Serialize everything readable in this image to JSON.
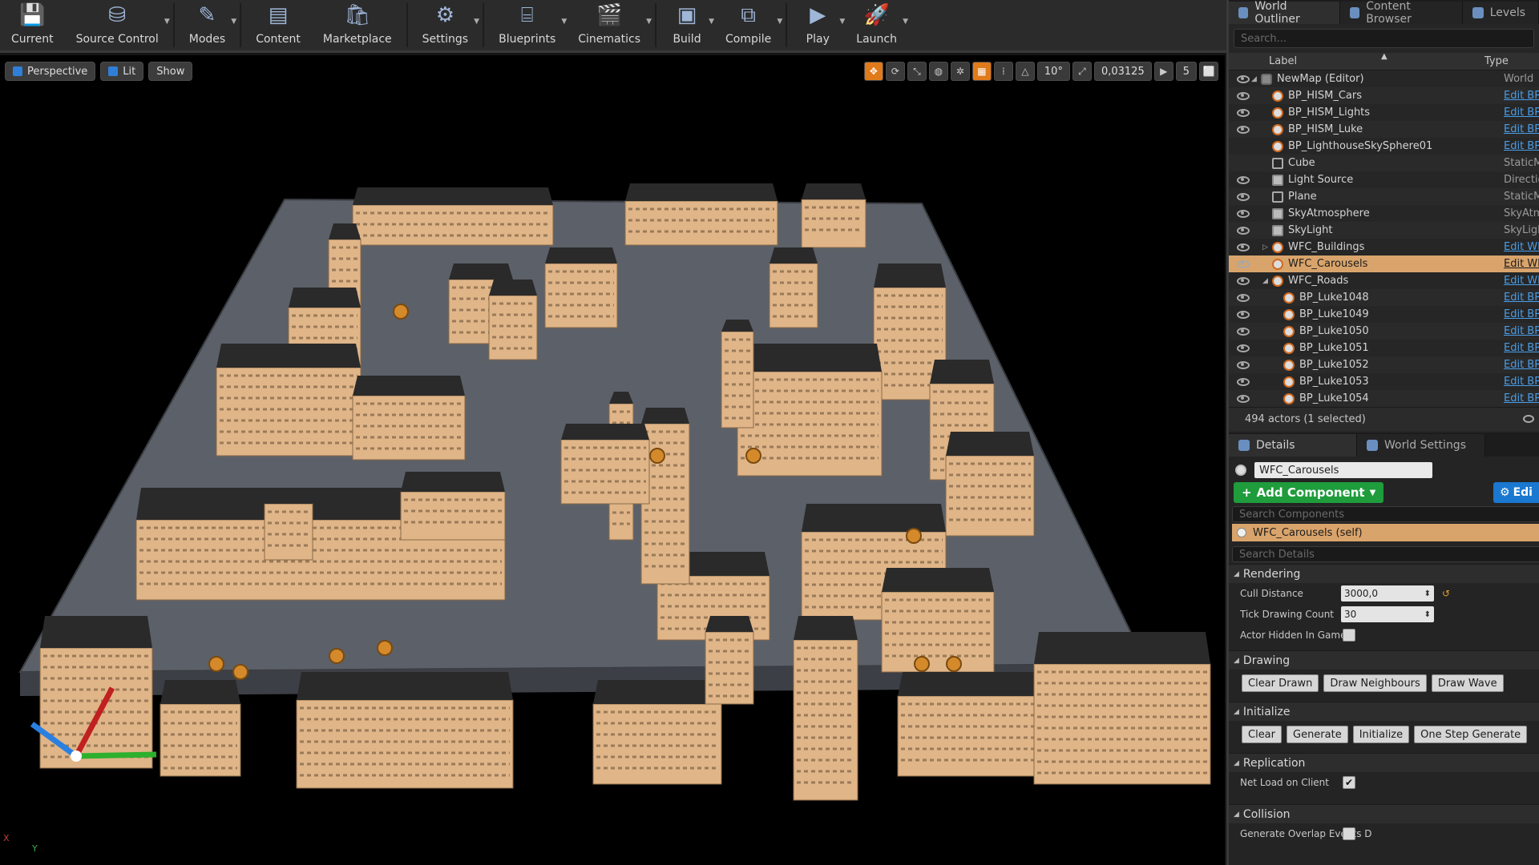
{
  "toolbar": {
    "buttons": [
      {
        "label": "Current",
        "icon": "save-icon",
        "caret": false
      },
      {
        "label": "Source Control",
        "icon": "source-control-icon",
        "caret": true
      },
      {
        "label": "Modes",
        "icon": "modes-icon",
        "caret": true
      },
      {
        "label": "Content",
        "icon": "content-icon",
        "caret": false
      },
      {
        "label": "Marketplace",
        "icon": "marketplace-icon",
        "caret": false
      },
      {
        "label": "Settings",
        "icon": "settings-icon",
        "caret": true
      },
      {
        "label": "Blueprints",
        "icon": "blueprints-icon",
        "caret": true
      },
      {
        "label": "Cinematics",
        "icon": "cinematics-icon",
        "caret": true
      },
      {
        "label": "Build",
        "icon": "build-icon",
        "caret": true
      },
      {
        "label": "Compile",
        "icon": "compile-icon",
        "caret": true
      },
      {
        "label": "Play",
        "icon": "play-icon",
        "caret": true
      },
      {
        "label": "Launch",
        "icon": "launch-icon",
        "caret": true
      }
    ]
  },
  "viewport": {
    "view_mode": "Perspective",
    "lit_mode": "Lit",
    "show_label": "Show",
    "angle_snap": "10°",
    "scale_snap": "0,03125",
    "camera_speed": "5",
    "axis_labels": {
      "x": "X",
      "y": "Y"
    }
  },
  "outliner": {
    "tab_label": "World Outliner",
    "content_tab_label": "Content Browser",
    "extra_tab_label": "Levels",
    "search_placeholder": "Search...",
    "col_label": "Label",
    "col_type": "Type",
    "rows": [
      {
        "label": "NewMap (Editor)",
        "type": "World",
        "depth": 0,
        "kind": "world",
        "visible": true,
        "expanded": true,
        "link": false
      },
      {
        "label": "BP_HISM_Cars",
        "type": "Edit BP",
        "depth": 1,
        "kind": "bp",
        "visible": true,
        "link": true
      },
      {
        "label": "BP_HISM_Lights",
        "type": "Edit BP",
        "depth": 1,
        "kind": "bp",
        "visible": true,
        "link": true
      },
      {
        "label": "BP_HISM_Luke",
        "type": "Edit BP",
        "depth": 1,
        "kind": "bp",
        "visible": true,
        "link": true
      },
      {
        "label": "BP_LighthouseSkySphere01",
        "type": "Edit BP",
        "depth": 1,
        "kind": "bp",
        "visible": false,
        "link": true
      },
      {
        "label": "Cube",
        "type": "StaticMesh",
        "depth": 1,
        "kind": "mesh",
        "visible": false,
        "link": false
      },
      {
        "label": "Light Source",
        "type": "DirectionalLight",
        "depth": 1,
        "kind": "light",
        "visible": true,
        "link": false
      },
      {
        "label": "Plane",
        "type": "StaticMesh",
        "depth": 1,
        "kind": "mesh",
        "visible": true,
        "link": false
      },
      {
        "label": "SkyAtmosphere",
        "type": "SkyAtmosphere",
        "depth": 1,
        "kind": "light",
        "visible": true,
        "link": false
      },
      {
        "label": "SkyLight",
        "type": "SkyLight",
        "depth": 1,
        "kind": "light",
        "visible": true,
        "link": false
      },
      {
        "label": "WFC_Buildings",
        "type": "Edit WFC",
        "depth": 1,
        "kind": "bp",
        "visible": true,
        "collapsed": true,
        "link": true
      },
      {
        "label": "WFC_Carousels",
        "type": "Edit WFC",
        "depth": 1,
        "kind": "bp",
        "visible": true,
        "selected": true,
        "link": true
      },
      {
        "label": "WFC_Roads",
        "type": "Edit WFC",
        "depth": 1,
        "kind": "bp",
        "visible": true,
        "expanded": true,
        "link": true
      },
      {
        "label": "BP_Luke1048",
        "type": "Edit BP",
        "depth": 2,
        "kind": "bp",
        "visible": true,
        "link": true
      },
      {
        "label": "BP_Luke1049",
        "type": "Edit BP",
        "depth": 2,
        "kind": "bp",
        "visible": true,
        "link": true
      },
      {
        "label": "BP_Luke1050",
        "type": "Edit BP",
        "depth": 2,
        "kind": "bp",
        "visible": true,
        "link": true
      },
      {
        "label": "BP_Luke1051",
        "type": "Edit BP",
        "depth": 2,
        "kind": "bp",
        "visible": true,
        "link": true
      },
      {
        "label": "BP_Luke1052",
        "type": "Edit BP",
        "depth": 2,
        "kind": "bp",
        "visible": true,
        "link": true
      },
      {
        "label": "BP_Luke1053",
        "type": "Edit BP",
        "depth": 2,
        "kind": "bp",
        "visible": true,
        "link": true
      },
      {
        "label": "BP_Luke1054",
        "type": "Edit BP",
        "depth": 2,
        "kind": "bp",
        "visible": true,
        "link": true
      }
    ],
    "actor_count": "494 actors (1 selected)"
  },
  "details": {
    "tab_label": "Details",
    "world_settings_tab": "World Settings",
    "actor_name": "WFC_Carousels",
    "add_component": "Add Component",
    "edit_blueprint": "Edi",
    "search_components_placeholder": "Search Components",
    "component_self": "WFC_Carousels (self)",
    "search_details_placeholder": "Search Details",
    "rendering": {
      "title": "Rendering",
      "cull_distance_label": "Cull Distance",
      "cull_distance_value": "3000,0",
      "tick_drawing_count_label": "Tick Drawing Count",
      "tick_drawing_count_value": "30",
      "actor_hidden_label": "Actor Hidden In Game"
    },
    "drawing": {
      "title": "Drawing",
      "buttons": [
        "Clear Drawn",
        "Draw Neighbours",
        "Draw Wave"
      ]
    },
    "initialize": {
      "title": "Initialize",
      "buttons": [
        "Clear",
        "Generate",
        "Initialize",
        "One Step Generate"
      ]
    },
    "replication": {
      "title": "Replication",
      "net_load_label": "Net Load on Client"
    },
    "collision": {
      "title": "Collision",
      "overlap_label": "Generate Overlap Events D"
    }
  },
  "colors": {
    "selected_row": "#d9a46b",
    "link": "#4a9ee8",
    "add_component": "#1f9c3c",
    "edit_blueprint": "#1a78d0",
    "building_face": "#e0b588",
    "building_roof": "#2a2a2a",
    "ground": "#5c6068"
  }
}
